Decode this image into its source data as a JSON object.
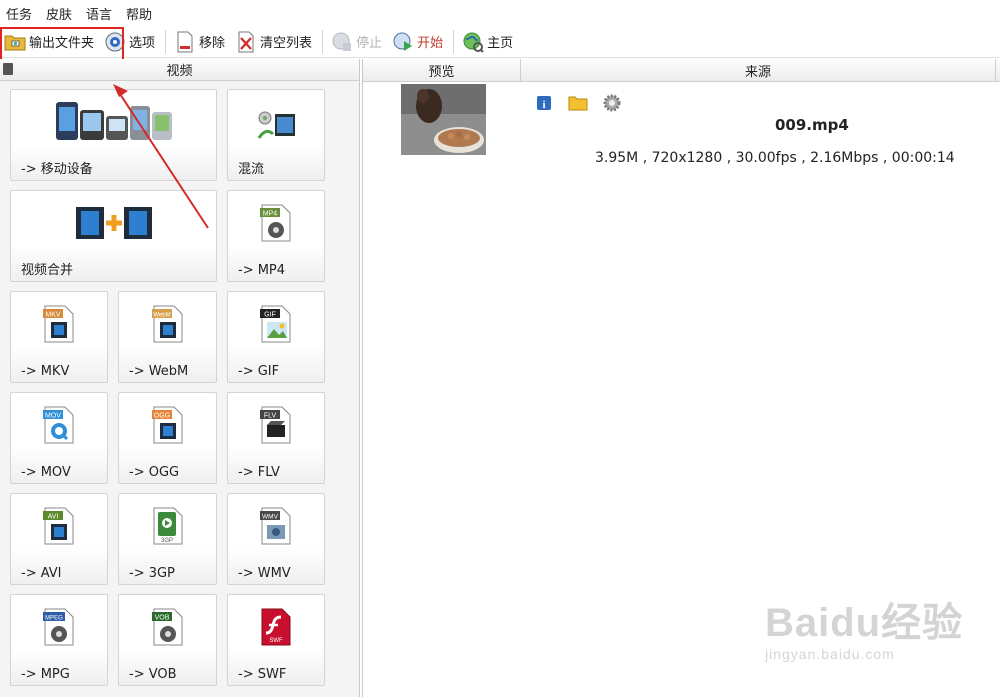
{
  "menu": [
    "任务",
    "皮肤",
    "语言",
    "帮助"
  ],
  "toolbar": {
    "output_folder": "输出文件夹",
    "options": "选项",
    "remove": "移除",
    "clear_list": "清空列表",
    "stop": "停止",
    "start": "开始",
    "home": "主页"
  },
  "left_panel": {
    "header": "视频",
    "tiles": [
      {
        "label": "-> 移动设备",
        "icon": "mobile-devices-icon"
      },
      {
        "label": "混流",
        "icon": "mux-icon"
      },
      {
        "label": "视频合并",
        "icon": "video-join-icon"
      },
      {
        "label": "-> MP4",
        "icon": "mp4-file-icon",
        "badge": "MP4"
      },
      {
        "label": "-> MKV",
        "icon": "mkv-file-icon",
        "badge": "MKV"
      },
      {
        "label": "-> WebM",
        "icon": "webm-file-icon",
        "badge": "WebM"
      },
      {
        "label": "-> GIF",
        "icon": "gif-file-icon",
        "badge": "GIF"
      },
      {
        "label": "-> MOV",
        "icon": "mov-file-icon",
        "badge": "MOV"
      },
      {
        "label": "-> OGG",
        "icon": "ogg-file-icon",
        "badge": "OGG"
      },
      {
        "label": "-> FLV",
        "icon": "flv-file-icon",
        "badge": "FLV"
      },
      {
        "label": "-> AVI",
        "icon": "avi-file-icon",
        "badge": "AVI"
      },
      {
        "label": "-> 3GP",
        "icon": "3gp-file-icon",
        "badge": "3GP"
      },
      {
        "label": "-> WMV",
        "icon": "wmv-file-icon",
        "badge": "WMV"
      },
      {
        "label": "-> MPG",
        "icon": "mpg-file-icon",
        "badge": "MPEG"
      },
      {
        "label": "-> VOB",
        "icon": "vob-file-icon",
        "badge": "VOB"
      },
      {
        "label": "-> SWF",
        "icon": "swf-file-icon",
        "badge": "SWF"
      }
    ]
  },
  "right_panel": {
    "columns": [
      "预览",
      "来源"
    ],
    "files": [
      {
        "name": "009.mp4",
        "info": "3.95M , 720x1280 , 30.00fps , 2.16Mbps , 00:00:14"
      }
    ]
  },
  "watermark": {
    "brand": "Baidu经验",
    "url": "jingyan.baidu.com"
  },
  "colors": {
    "highlight": "#e02424",
    "start_text": "#c0392b",
    "disabled_text": "#b3b3b3"
  }
}
